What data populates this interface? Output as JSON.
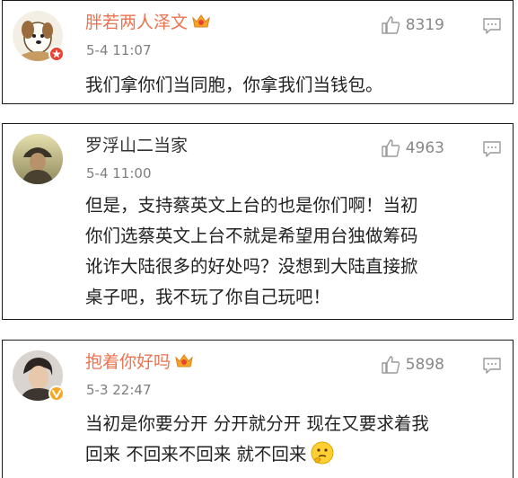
{
  "comments": [
    {
      "name": "胖若两人泽文",
      "time": "5-4 11:07",
      "likes": "8319",
      "content_lines": [
        "我们拿你们当同胞，你拿我们当钱包。"
      ],
      "has_vip_icon": true,
      "name_color": "#eb7350",
      "badge": "red-star-badge-icon"
    },
    {
      "name": "罗浮山二当家",
      "time": "5-4 11:00",
      "likes": "4963",
      "content_lines": [
        "但是，支持蔡英文上台的也是你们啊！当初",
        "你们选蔡英文上台不就是希望用台独做筹码",
        "讹诈大陆很多的好处吗？没想到大陆直接掀",
        "桌子吧，我不玩了你自己玩吧！"
      ],
      "has_vip_icon": false,
      "name_color": "#333333"
    },
    {
      "name": "抱着你好吗",
      "time": "5-3 22:47",
      "likes": "5898",
      "content_lines": [
        "当初是你要分开 分开就分开 现在又要求着我",
        "回来 不回来不回来 就不回来"
      ],
      "has_vip_icon": true,
      "name_color": "#eb7350",
      "badge": "verified-v-badge-icon",
      "trailing_emoji": "thinking-emoji-icon"
    }
  ]
}
